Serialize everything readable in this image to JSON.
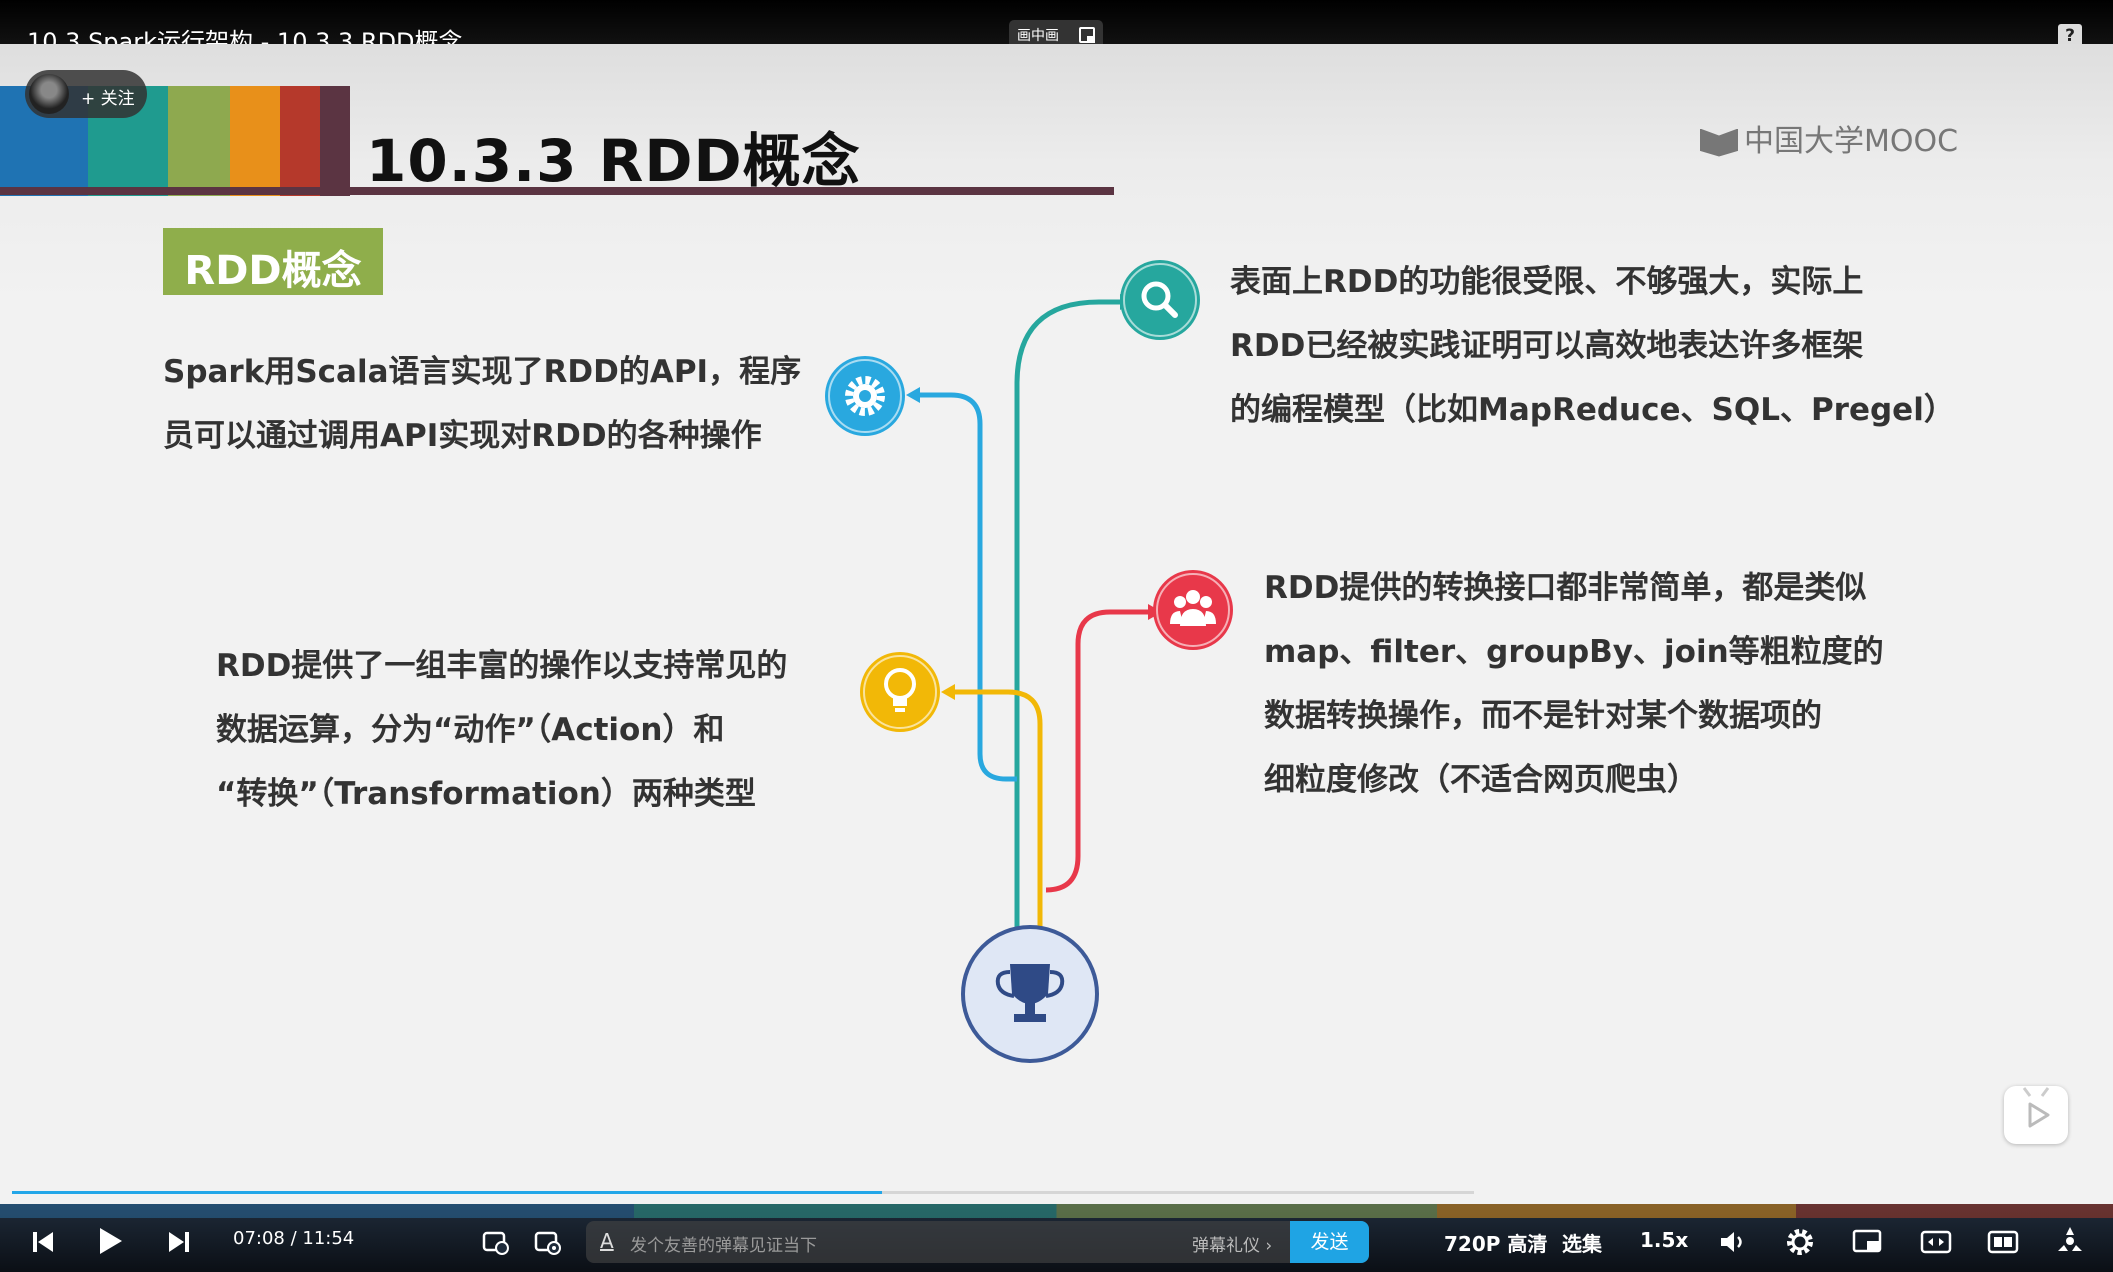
{
  "player": {
    "title": "10.3 Spark运行架构 - 10.3.3 RDD概念",
    "pip_label": "画中画",
    "help_icon": "?",
    "follow_label": "+ 关注"
  },
  "slide": {
    "title": "10.3.3  RDD概念",
    "logo_text": "中国大学MOOC",
    "section_badge": "RDD概念",
    "stripe_colors": [
      "#1f73b3",
      "#1f9b8f",
      "#8ea94f",
      "#e8901a",
      "#b5392b",
      "#5b3442"
    ],
    "items": [
      {
        "icon": "gear-icon",
        "color": "#29a8df",
        "lines": [
          "Spark用Scala语言实现了RDD的API，程序",
          "员可以通过调用API实现对RDD的各种操作"
        ]
      },
      {
        "icon": "lightbulb-icon",
        "color": "#f2b807",
        "lines": [
          "RDD提供了一组丰富的操作以支持常见的",
          "数据运算，分为“动作”（Action）和",
          "“转换”（Transformation）两种类型"
        ]
      },
      {
        "icon": "search-icon",
        "color": "#26a79e",
        "lines": [
          "表面上RDD的功能很受限、不够强大，实际上",
          "RDD已经被实践证明可以高效地表达许多框架",
          "的编程模型（比如MapReduce、SQL、Pregel）"
        ]
      },
      {
        "icon": "group-icon",
        "color": "#e8384a",
        "lines": [
          "RDD提供的转换接口都非常简单，都是类似",
          "map、filter、groupBy、join等粗粒度的",
          "数据转换操作，而不是针对某个数据项的",
          "细粒度修改（不适合网页爬虫）"
        ]
      }
    ],
    "center_icon": "trophy-icon"
  },
  "controls": {
    "time": "07:08 / 11:54",
    "progress": 0.595,
    "danmaku_placeholder": "发个友善的弹幕见证当下",
    "danmaku_etiquette": "弹幕礼仪 ›",
    "send_label": "发送",
    "quality": "720P 高清",
    "episodes": "选集",
    "speed": "1.5x"
  }
}
